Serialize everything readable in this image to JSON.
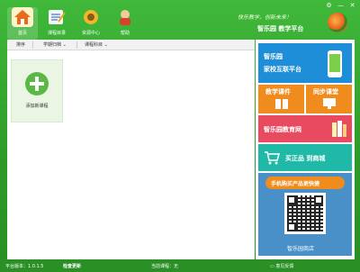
{
  "header": {
    "nav": [
      {
        "label": "首页",
        "icon": "home-icon"
      },
      {
        "label": "课程目录",
        "icon": "course-catalog-icon"
      },
      {
        "label": "资源中心",
        "icon": "resource-center-icon"
      },
      {
        "label": "帮助",
        "icon": "help-icon"
      }
    ],
    "slogan": "快乐教学，创新未来！",
    "brand": "智乐园 教学平台",
    "window_controls": [
      "⚙",
      "—",
      "✕"
    ]
  },
  "toolbar": {
    "items": [
      "排序",
      "学期归档",
      "课程科目"
    ]
  },
  "main": {
    "add_course_label": "添加新课程"
  },
  "sidebar": {
    "ad1": {
      "title": "智乐园",
      "subtitle": "家校互联平台"
    },
    "ad2": {
      "left": "教学课件",
      "right": "同步课堂"
    },
    "ad3": {
      "title": "智乐园教育网"
    },
    "ad4": {
      "title": "买正品 到商城"
    },
    "ad5": {
      "title": "手机购买产品更快捷",
      "footer": "智乐园商店"
    }
  },
  "status": {
    "version": "平台版本：1.0.1.5",
    "update": "检查更新",
    "current_course": "当前课程：无",
    "feedback": "意见反馈"
  },
  "colors": {
    "brand_green": "#2f9e2a",
    "accent_orange": "#f08b1d",
    "accent_blue": "#1f8ed8"
  }
}
